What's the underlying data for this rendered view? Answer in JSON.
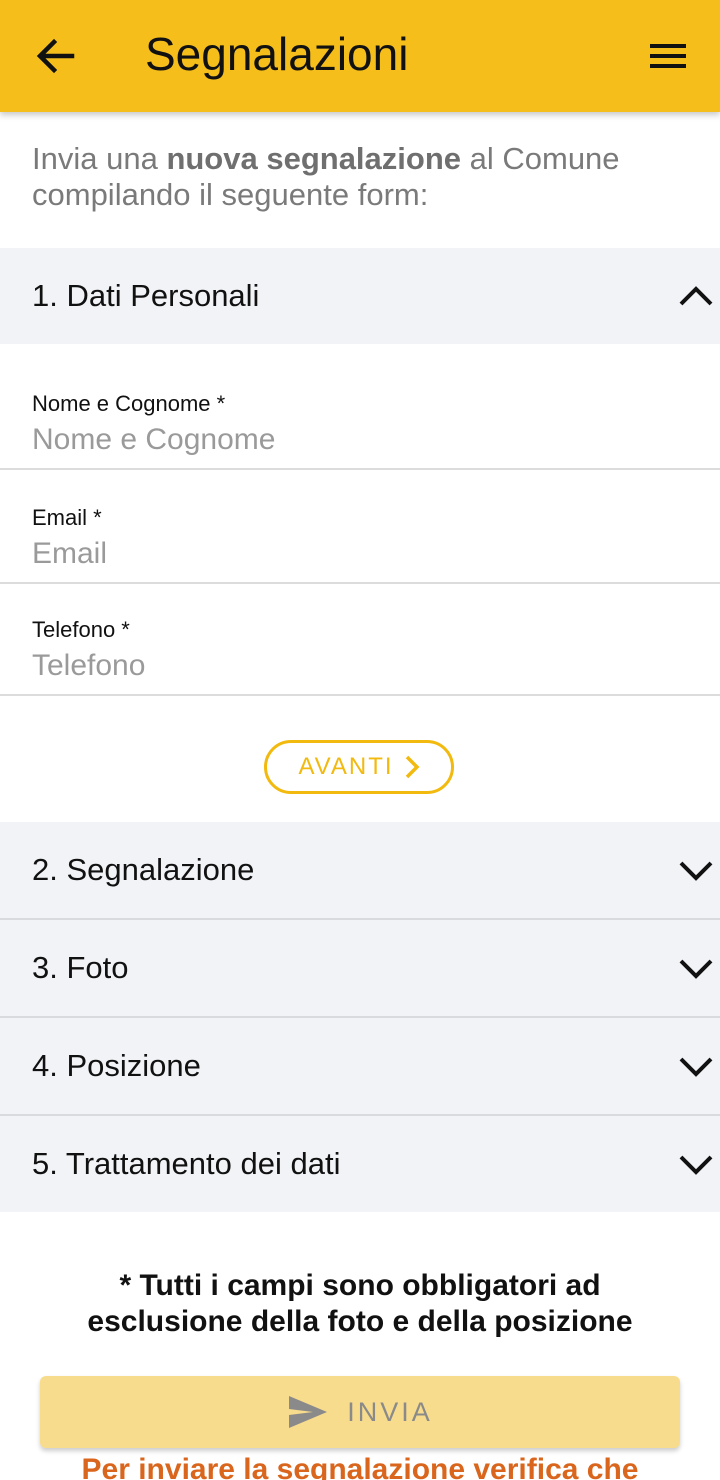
{
  "header": {
    "title": "Segnalazioni",
    "back_icon": "arrow-left-icon",
    "menu_icon": "hamburger-menu-icon",
    "color": "#f5be1b"
  },
  "intro": {
    "prefix": "Invia una ",
    "bold": "nuova segnalazione",
    "suffix": " al Comune compilando il seguente form:"
  },
  "sections": [
    {
      "label": "1. Dati Personali",
      "expanded": true
    },
    {
      "label": "2. Segnalazione",
      "expanded": false
    },
    {
      "label": "3. Foto",
      "expanded": false
    },
    {
      "label": "4. Posizione",
      "expanded": false
    },
    {
      "label": "5. Trattamento dei dati",
      "expanded": false
    }
  ],
  "fields": [
    {
      "label": "Nome e Cognome *",
      "placeholder": "Nome e Cognome",
      "value": ""
    },
    {
      "label": "Email *",
      "placeholder": "Email",
      "value": ""
    },
    {
      "label": "Telefono *",
      "placeholder": "Telefono",
      "value": ""
    }
  ],
  "next_button": {
    "label": "AVANTI",
    "icon": "chevron-right-icon"
  },
  "note": "* Tutti i campi sono obbligatori ad esclusione della foto e della posizione",
  "submit_button": {
    "label": "INVIA",
    "icon": "send-icon"
  },
  "warning": "Per inviare la segnalazione verifica che",
  "colors": {
    "accent": "#f5be1b",
    "section_bg": "#f2f3f7",
    "warning": "#d9661c"
  }
}
